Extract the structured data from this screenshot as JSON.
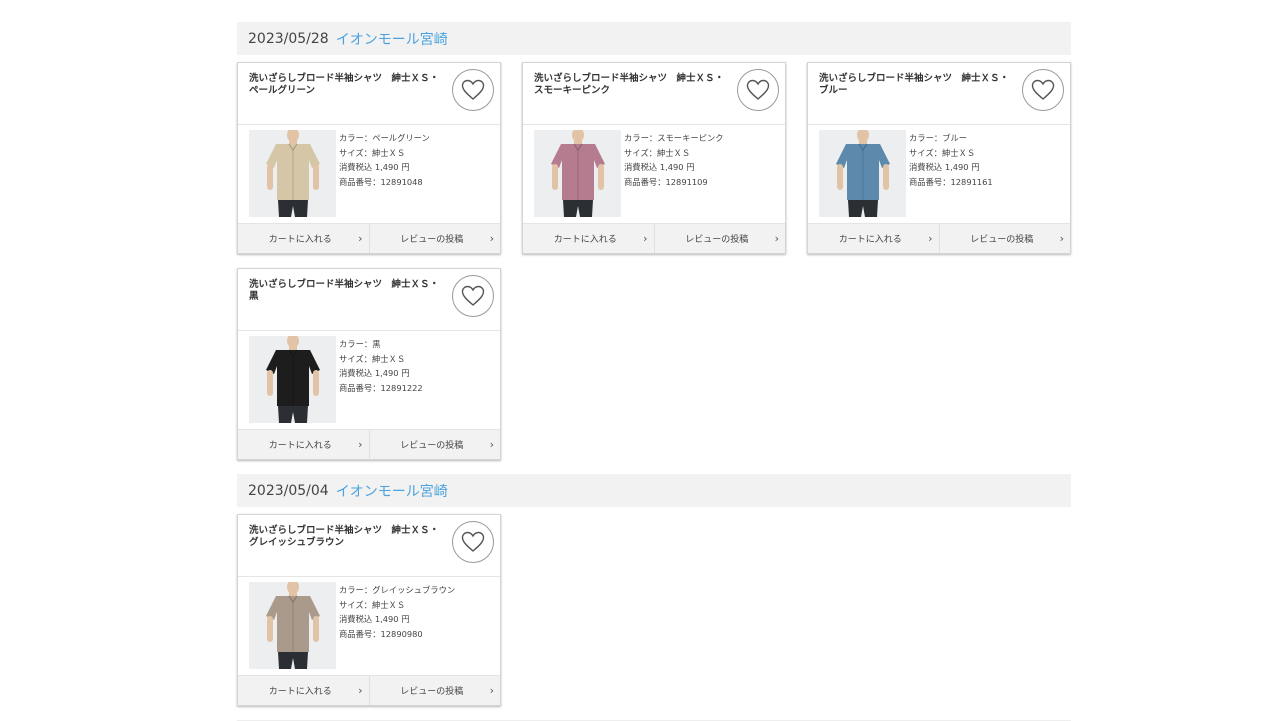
{
  "sections": [
    {
      "date": "2023/05/28",
      "store": "イオンモール宮崎",
      "items": [
        {
          "title": "洗いざらしブロード半袖シャツ　紳士ＸＳ・ペールグリーン",
          "color_label": "カラー：ペールグリーン",
          "size_label": "サイズ：紳士ＸＳ",
          "price_label": "消費税込 1,490 円",
          "number_label": "商品番号：12891048",
          "shirt_color": "#d4c6a6",
          "cart_label": "カートに入れる",
          "review_label": "レビューの投稿",
          "favorite_icon": "heart-icon"
        },
        {
          "title": "洗いざらしブロード半袖シャツ　紳士ＸＳ・スモーキーピンク",
          "color_label": "カラー：スモーキーピンク",
          "size_label": "サイズ：紳士ＸＳ",
          "price_label": "消費税込 1,490 円",
          "number_label": "商品番号：12891109",
          "shirt_color": "#b47c8e",
          "cart_label": "カートに入れる",
          "review_label": "レビューの投稿",
          "favorite_icon": "heart-icon"
        },
        {
          "title": "洗いざらしブロード半袖シャツ　紳士ＸＳ・ブルー",
          "color_label": "カラー：ブルー",
          "size_label": "サイズ：紳士ＸＳ",
          "price_label": "消費税込 1,490 円",
          "number_label": "商品番号：12891161",
          "shirt_color": "#5d89ad",
          "cart_label": "カートに入れる",
          "review_label": "レビューの投稿",
          "favorite_icon": "heart-icon"
        },
        {
          "title": "洗いざらしブロード半袖シャツ　紳士ＸＳ・黒",
          "color_label": "カラー：黒",
          "size_label": "サイズ：紳士ＸＳ",
          "price_label": "消費税込 1,490 円",
          "number_label": "商品番号：12891222",
          "shirt_color": "#1d1d1d",
          "cart_label": "カートに入れる",
          "review_label": "レビューの投稿",
          "favorite_icon": "heart-icon"
        }
      ]
    },
    {
      "date": "2023/05/04",
      "store": "イオンモール宮崎",
      "items": [
        {
          "title": "洗いざらしブロード半袖シャツ　紳士ＸＳ・グレイッシュブラウン",
          "color_label": "カラー：グレイッシュブラウン",
          "size_label": "サイズ：紳士ＸＳ",
          "price_label": "消費税込 1,490 円",
          "number_label": "商品番号：12890980",
          "shirt_color": "#a99a8c",
          "cart_label": "カートに入れる",
          "review_label": "レビューの投稿",
          "favorite_icon": "heart-icon"
        }
      ]
    }
  ],
  "colors": {
    "store_link": "#4aa3df",
    "header_bg": "#f2f2f2",
    "action_bg": "#f2f2f2",
    "pants": "#2b2e33",
    "skin": "#e2c3a5"
  }
}
